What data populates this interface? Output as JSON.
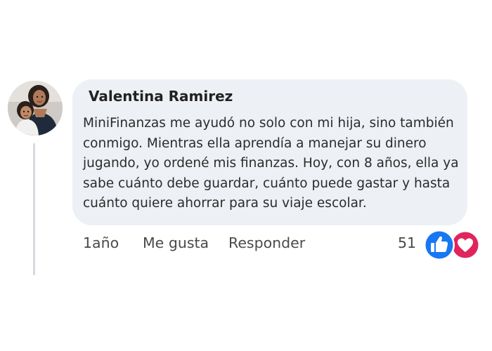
{
  "comment": {
    "author": "Valentina Ramirez",
    "text": "MiniFinanzas me ayudó no solo con mi hija, sino también\nconmigo. Mientras ella aprendía a manejar su dinero\njugando, yo ordené mis finanzas. Hoy, con 8 años, ella ya\nsabe cuánto debe guardar, cuánto puede gastar y hasta\ncuánto quiere ahorrar para su viaje escolar.",
    "avatar_icon": "avatar-photo-icon"
  },
  "actions": {
    "time": "1año",
    "like_label": "Me gusta",
    "reply_label": "Responder"
  },
  "reactions": {
    "count": "51",
    "types": [
      "like",
      "love"
    ],
    "colors": {
      "like": "#1877f2",
      "love": "#e0245e"
    }
  }
}
